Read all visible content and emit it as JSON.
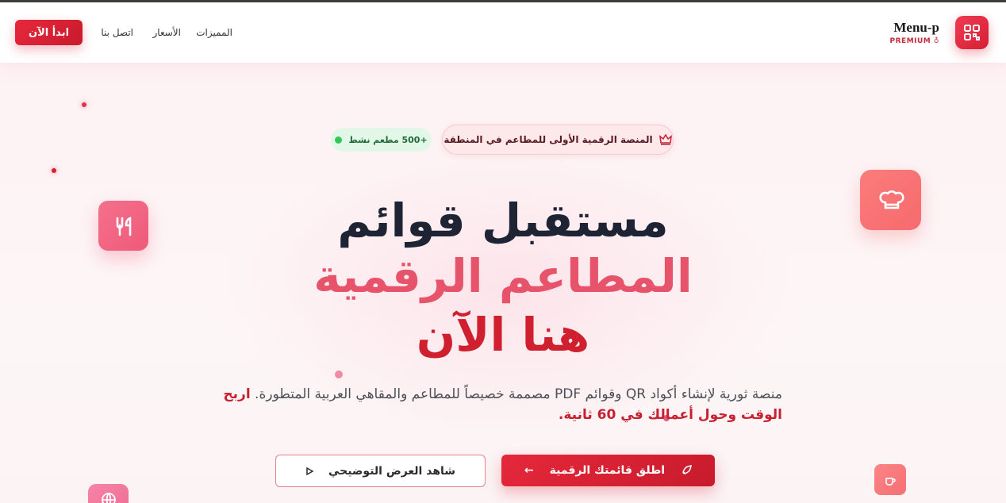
{
  "header": {
    "brand_name": "Menu-p",
    "brand_sub": "PREMIUM",
    "nav": {
      "features": "المميزات",
      "prices": "الأسعار",
      "contact": "اتصل بنا"
    },
    "start_button": "ابدأ الآن"
  },
  "hero": {
    "badge_main": "المنصة الرقمية الأولى للمطاعم في المنطقة",
    "badge_live": "+500 مطعم نشط",
    "heading_line1": "مستقبل قوائم",
    "heading_line2": "المطاعم الرقمية",
    "heading_line3": "هنا الآن",
    "description": "منصة ثورية لإنشاء أكواد QR وقوائم PDF مصممة خصيصاً للمطاعم والمقاهي العربية المتطورة.",
    "description_highlight": "اربح الوقت وحول أعمالك في 60 ثانية.",
    "cta_primary": "اطلق قائمتك الرقمية",
    "cta_secondary": "شاهد العرض التوضيحي"
  },
  "icons": {
    "logo": "qr-code-icon",
    "badge": "crown-icon",
    "float_left": "utensils-icon",
    "float_right": "chef-hat-icon",
    "float_small": "coffee-icon",
    "float_bottom": "globe-icon"
  },
  "colors": {
    "primary": "#d61f34",
    "heading_dark": "#1e2434",
    "heading_pink": "#e6536a",
    "live_green": "#34c759"
  }
}
